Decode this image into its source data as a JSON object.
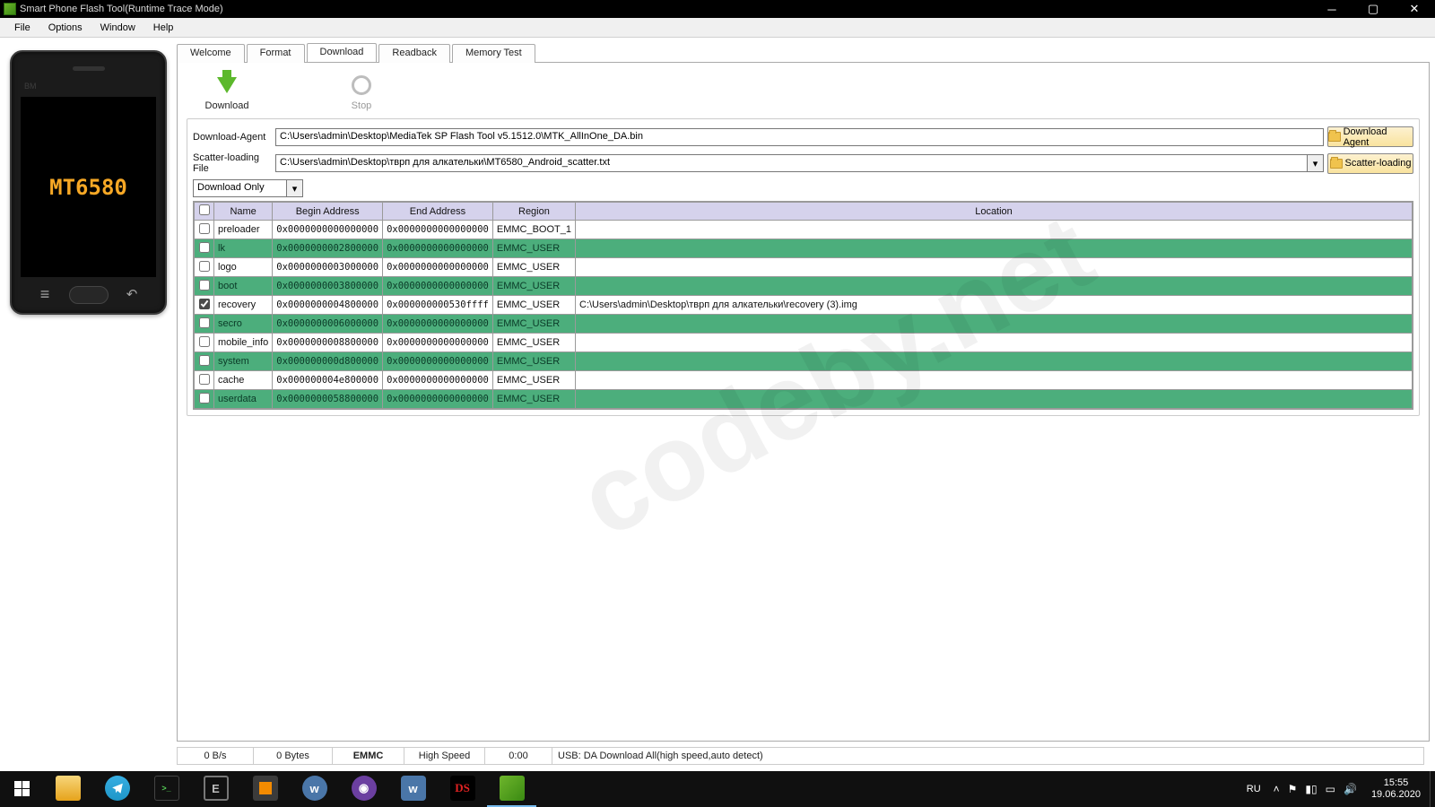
{
  "window": {
    "title": "Smart Phone Flash Tool(Runtime Trace Mode)"
  },
  "menu": {
    "file": "File",
    "options": "Options",
    "window": "Window",
    "help": "Help"
  },
  "phone": {
    "brand": "BM",
    "chip": "MT6580"
  },
  "tabs": {
    "welcome": "Welcome",
    "format": "Format",
    "download": "Download",
    "readback": "Readback",
    "memtest": "Memory Test"
  },
  "bigButtons": {
    "download": "Download",
    "stop": "Stop"
  },
  "fileRows": {
    "daLabel": "Download-Agent",
    "daPath": "C:\\Users\\admin\\Desktop\\MediaTek SP Flash Tool v5.1512.0\\MTK_AllInOne_DA.bin",
    "daBtn": "Download Agent",
    "scLabel": "Scatter-loading File",
    "scPath": "C:\\Users\\admin\\Desktop\\тврп для алкательки\\MT6580_Android_scatter.txt",
    "scBtn": "Scatter-loading",
    "mode": "Download Only"
  },
  "grid": {
    "headers": {
      "name": "Name",
      "begin": "Begin Address",
      "end": "End Address",
      "region": "Region",
      "location": "Location"
    },
    "rows": [
      {
        "chk": false,
        "name": "preloader",
        "begin": "0x0000000000000000",
        "end": "0x0000000000000000",
        "region": "EMMC_BOOT_1",
        "loc": "",
        "green": false
      },
      {
        "chk": false,
        "name": "lk",
        "begin": "0x0000000002800000",
        "end": "0x0000000000000000",
        "region": "EMMC_USER",
        "loc": "",
        "green": true
      },
      {
        "chk": false,
        "name": "logo",
        "begin": "0x0000000003000000",
        "end": "0x0000000000000000",
        "region": "EMMC_USER",
        "loc": "",
        "green": false
      },
      {
        "chk": false,
        "name": "boot",
        "begin": "0x0000000003800000",
        "end": "0x0000000000000000",
        "region": "EMMC_USER",
        "loc": "",
        "green": true
      },
      {
        "chk": true,
        "name": "recovery",
        "begin": "0x0000000004800000",
        "end": "0x000000000530ffff",
        "region": "EMMC_USER",
        "loc": "C:\\Users\\admin\\Desktop\\тврп для алкательки\\recovery (3).img",
        "green": false
      },
      {
        "chk": false,
        "name": "secro",
        "begin": "0x0000000006000000",
        "end": "0x0000000000000000",
        "region": "EMMC_USER",
        "loc": "",
        "green": true
      },
      {
        "chk": false,
        "name": "mobile_info",
        "begin": "0x0000000008800000",
        "end": "0x0000000000000000",
        "region": "EMMC_USER",
        "loc": "",
        "green": false
      },
      {
        "chk": false,
        "name": "system",
        "begin": "0x000000000d800000",
        "end": "0x0000000000000000",
        "region": "EMMC_USER",
        "loc": "",
        "green": true
      },
      {
        "chk": false,
        "name": "cache",
        "begin": "0x000000004e800000",
        "end": "0x0000000000000000",
        "region": "EMMC_USER",
        "loc": "",
        "green": false
      },
      {
        "chk": false,
        "name": "userdata",
        "begin": "0x0000000058800000",
        "end": "0x0000000000000000",
        "region": "EMMC_USER",
        "loc": "",
        "green": true
      }
    ]
  },
  "status": {
    "speed": "0 B/s",
    "bytes": "0 Bytes",
    "storage": "EMMC",
    "mode": "High Speed",
    "time": "0:00",
    "msg": "USB: DA Download All(high speed,auto detect)"
  },
  "watermark": "codeby.net",
  "tray": {
    "lang": "RU",
    "time": "15:55",
    "date": "19.06.2020"
  }
}
